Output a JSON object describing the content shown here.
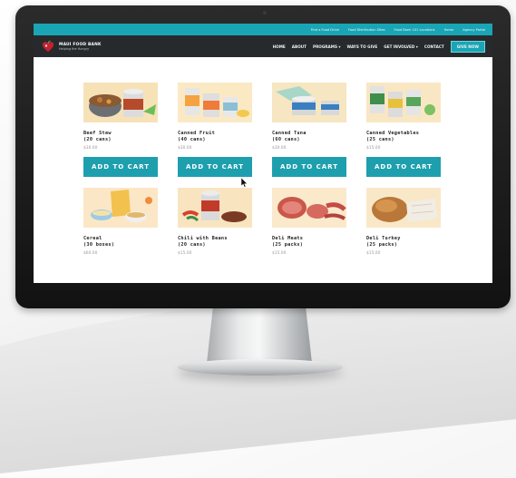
{
  "topbar": {
    "links": [
      "Find a Food Drive",
      "Food Distribution Sites",
      "Food Bank 101 Locations",
      "Home",
      "Agency Portal"
    ]
  },
  "brand": {
    "name": "MAUI FOOD BANK",
    "tagline": "Helping the Hungry"
  },
  "nav": {
    "items": [
      "HOME",
      "ABOUT",
      "PROGRAMS ▾",
      "WAYS TO GIVE",
      "GET INVOLVED ▾",
      "CONTACT"
    ],
    "cta": "GIVE NOW"
  },
  "products": [
    {
      "name": "Beef Stew\n(20 cans)",
      "price": "$30.00",
      "button": "ADD TO CART",
      "image": "beef-stew-icon"
    },
    {
      "name": "Canned Fruit\n(40 cans)",
      "price": "$30.00",
      "button": "ADD TO CART",
      "image": "canned-fruit-icon"
    },
    {
      "name": "Canned Tuna\n(60 cans)",
      "price": "$30.00",
      "button": "ADD TO CART",
      "image": "canned-tuna-icon"
    },
    {
      "name": "Canned Vegetables\n(25 cans)",
      "price": "$15.00",
      "button": "ADD TO CART",
      "image": "canned-vegetables-icon"
    },
    {
      "name": "Cereal\n(30 boxes)",
      "price": "$60.00",
      "image": "cereal-icon"
    },
    {
      "name": "Chili with Beans\n(20 cans)",
      "price": "$15.00",
      "image": "chili-icon"
    },
    {
      "name": "Deli Meats\n(25 packs)",
      "price": "$15.00",
      "image": "deli-meats-icon"
    },
    {
      "name": "Deli Turkey\n(25 packs)",
      "price": "$15.00",
      "image": "deli-turkey-icon"
    }
  ],
  "colors": {
    "accent": "#1e9fae",
    "topbar": "#1aa5b4",
    "nav": "#272a2d",
    "brand_red": "#c8202f"
  }
}
